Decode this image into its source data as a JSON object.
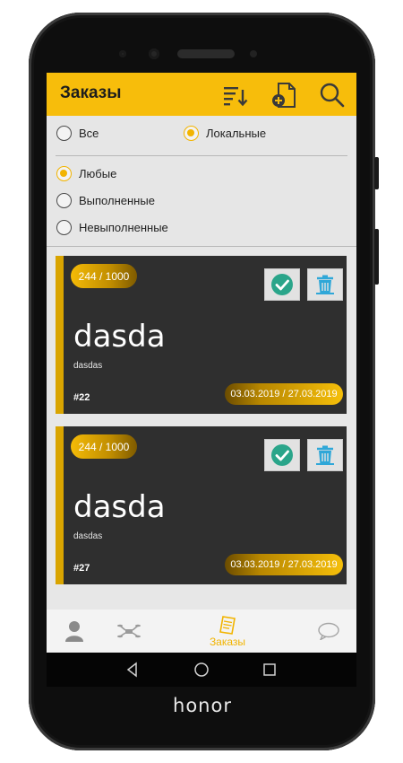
{
  "device": {
    "brand": "honor"
  },
  "appbar": {
    "title": "Заказы",
    "icons": [
      "sort-icon",
      "new-document-icon",
      "search-icon"
    ]
  },
  "filters": {
    "scope": [
      {
        "label": "Все",
        "selected": false
      },
      {
        "label": "Локальные",
        "selected": true
      }
    ],
    "status": [
      {
        "label": "Любые",
        "selected": true
      },
      {
        "label": "Выполненные",
        "selected": false
      },
      {
        "label": "Невыполненные",
        "selected": false
      }
    ]
  },
  "orders": [
    {
      "progress": "244 / 1000",
      "title": "dasda",
      "subtitle": "dasdas",
      "number": "#22",
      "dates": "03.03.2019 / 27.03.2019"
    },
    {
      "progress": "244 / 1000",
      "title": "dasda",
      "subtitle": "dasdas",
      "number": "#27",
      "dates": "03.03.2019 / 27.03.2019"
    }
  ],
  "bottom_nav": {
    "items": [
      {
        "icon": "profile-icon",
        "label": ""
      },
      {
        "icon": "drone-icon",
        "label": ""
      },
      {
        "icon": "orders-icon",
        "label": "Заказы",
        "active": true
      },
      {
        "icon": "chat-icon",
        "label": ""
      }
    ]
  },
  "colors": {
    "accent": "#f7bd0b",
    "card": "#2f2f2f",
    "check": "#2aa58a",
    "trash": "#2fa7d8"
  }
}
